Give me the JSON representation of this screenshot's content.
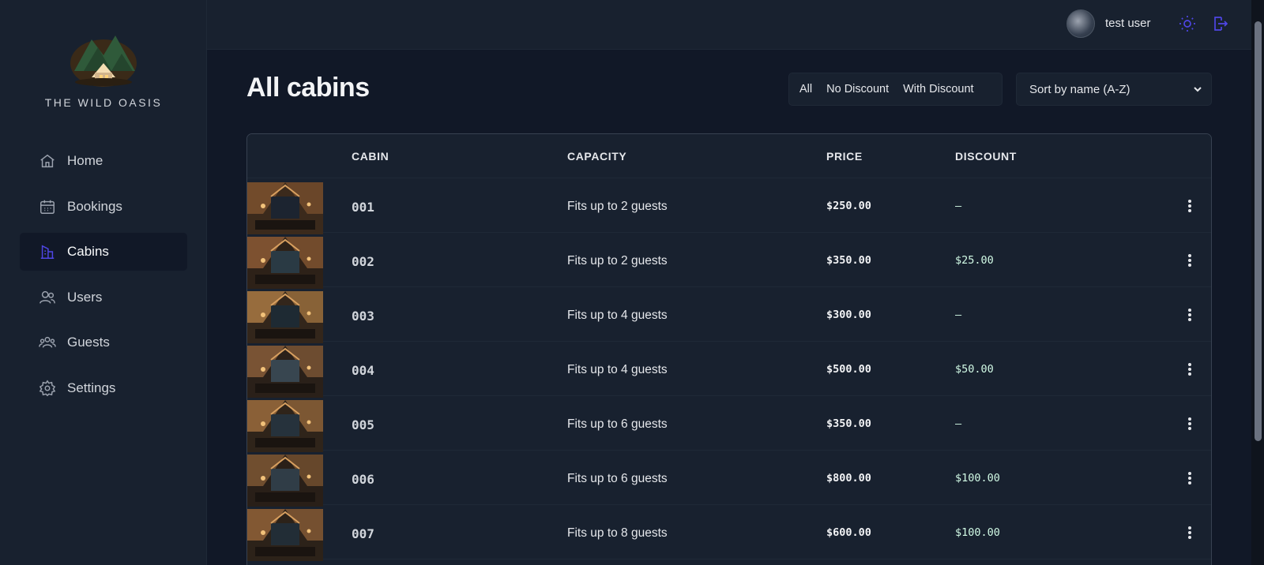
{
  "sidebar": {
    "logo_text": "THE WILD OASIS",
    "items": [
      {
        "label": "Home",
        "icon": "home-icon",
        "active": false
      },
      {
        "label": "Bookings",
        "icon": "calendar-icon",
        "active": false
      },
      {
        "label": "Cabins",
        "icon": "buildings-icon",
        "active": true
      },
      {
        "label": "Users",
        "icon": "users-icon",
        "active": false
      },
      {
        "label": "Guests",
        "icon": "user-group-icon",
        "active": false
      },
      {
        "label": "Settings",
        "icon": "gear-icon",
        "active": false
      }
    ]
  },
  "header": {
    "username": "test user",
    "icons": [
      "sun-icon",
      "logout-icon"
    ]
  },
  "main": {
    "title": "All cabins",
    "filter": {
      "options": [
        "All",
        "No Discount",
        "With Discount"
      ]
    },
    "sort": {
      "selected": "Sort by name (A-Z)"
    },
    "table": {
      "headers": [
        "CABIN",
        "CAPACITY",
        "PRICE",
        "DISCOUNT"
      ],
      "rows": [
        {
          "cabin": "001",
          "capacity": "Fits up to 2 guests",
          "price": "$250.00",
          "discount": "—"
        },
        {
          "cabin": "002",
          "capacity": "Fits up to 2 guests",
          "price": "$350.00",
          "discount": "$25.00"
        },
        {
          "cabin": "003",
          "capacity": "Fits up to 4 guests",
          "price": "$300.00",
          "discount": "—"
        },
        {
          "cabin": "004",
          "capacity": "Fits up to 4 guests",
          "price": "$500.00",
          "discount": "$50.00"
        },
        {
          "cabin": "005",
          "capacity": "Fits up to 6 guests",
          "price": "$350.00",
          "discount": "—"
        },
        {
          "cabin": "006",
          "capacity": "Fits up to 6 guests",
          "price": "$800.00",
          "discount": "$100.00"
        },
        {
          "cabin": "007",
          "capacity": "Fits up to 8 guests",
          "price": "$600.00",
          "discount": "$100.00"
        }
      ]
    }
  },
  "colors": {
    "accent": "#4f46e5",
    "sidebar_bg": "#18212f",
    "page_bg": "#111827",
    "discount_text": "#d1fae5"
  }
}
